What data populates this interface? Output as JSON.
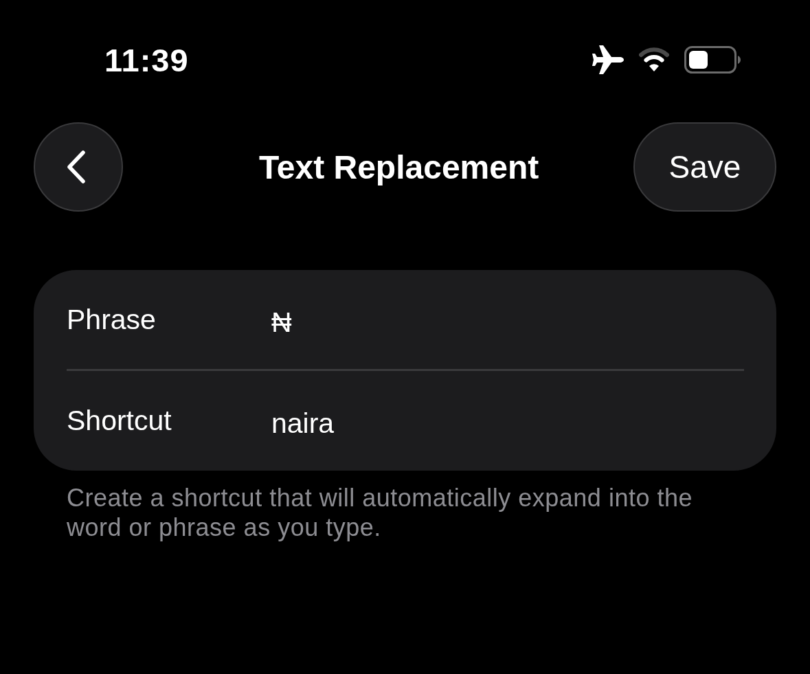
{
  "status_bar": {
    "time": "11:39"
  },
  "nav_bar": {
    "title": "Text Replacement",
    "save_button": "Save"
  },
  "form": {
    "rows": [
      {
        "label": "Phrase",
        "value": "₦"
      },
      {
        "label": "Shortcut",
        "value": "naira"
      }
    ]
  },
  "footer": "Create a shortcut that will automatically expand into the word or phrase as you type."
}
